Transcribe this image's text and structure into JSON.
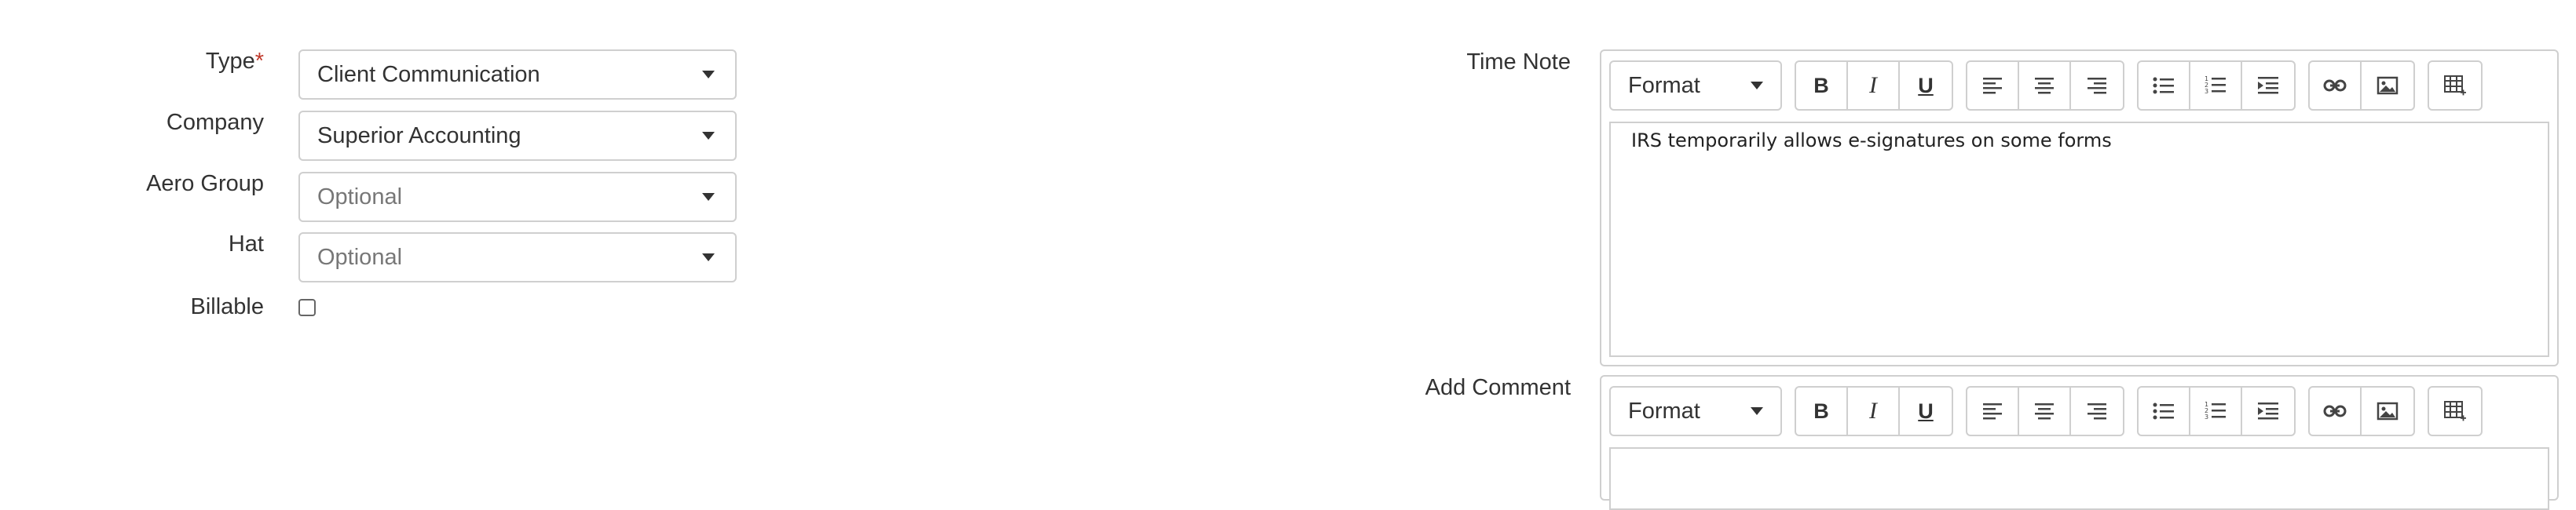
{
  "form": {
    "type": {
      "label": "Type",
      "required_mark": "*",
      "value": "Client Communication"
    },
    "company": {
      "label": "Company",
      "value": "Superior Accounting"
    },
    "aero_group": {
      "label": "Aero Group",
      "placeholder": "Optional"
    },
    "hat": {
      "label": "Hat",
      "placeholder": "Optional"
    },
    "billable": {
      "label": "Billable",
      "checked": false
    }
  },
  "time_note": {
    "label": "Time Note",
    "format_label": "Format",
    "content": "IRS temporarily allows e-signatures on some forms"
  },
  "add_comment": {
    "label": "Add Comment",
    "format_label": "Format",
    "content": ""
  },
  "toolbar": {
    "bold": "B",
    "italic": "I",
    "underline": "U",
    "icons": [
      "align-left-icon",
      "align-center-icon",
      "align-right-icon",
      "bullet-list-icon",
      "numbered-list-icon",
      "indent-icon",
      "link-icon",
      "image-icon",
      "table-icon"
    ]
  }
}
